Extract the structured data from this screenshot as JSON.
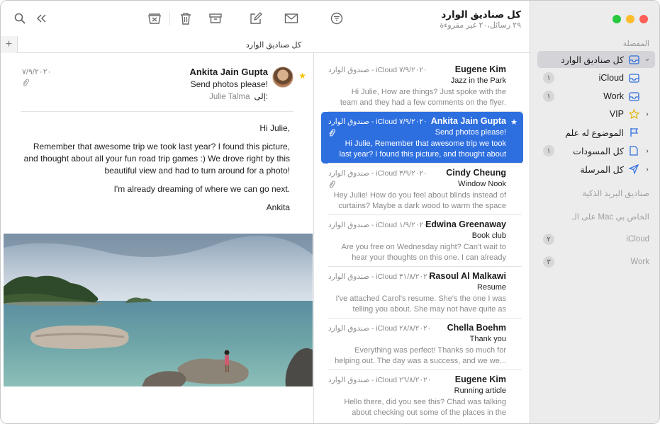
{
  "window": {
    "title": "كل صناديق الوارد",
    "subtitle": "٢٩ رسائل،٢٠ غير مقروءة"
  },
  "toolbar": {
    "search_icon": "search-icon",
    "collapse_icon": "double-chevron-left-icon",
    "junk_icon": "junk-icon",
    "trash_icon": "trash-icon",
    "archive_icon": "archive-icon",
    "compose_icon": "compose-icon",
    "mail_icon": "envelope-icon",
    "filter_icon": "filter-icon"
  },
  "tabbar": {
    "add_label": "+",
    "title": "كل صناديق الوارد"
  },
  "sidebar": {
    "favorites_label": "المفضلة",
    "items": [
      {
        "label": "كل صناديق الوارد",
        "badge": "",
        "icon": "inbox-icon"
      },
      {
        "label": "iCloud",
        "badge": "١",
        "icon": "inbox-icon"
      },
      {
        "label": "Work",
        "badge": "١",
        "icon": "inbox-icon"
      },
      {
        "label": "VIP",
        "badge": "",
        "icon": "star-icon"
      },
      {
        "label": "الموضوع له علم",
        "badge": "",
        "icon": "flag-icon"
      },
      {
        "label": "كل المسودات",
        "badge": "١",
        "icon": "document-icon"
      },
      {
        "label": "كل المرسلة",
        "badge": "",
        "icon": "paper-plane-icon"
      }
    ],
    "smart_mailboxes_label": "صناديق البريد الذكية",
    "on_my_mac_label": "على الـ Mac الخاص بي",
    "accounts": [
      {
        "label": "iCloud",
        "badge": "٢"
      },
      {
        "label": "Work",
        "badge": "٣"
      }
    ]
  },
  "messages": [
    {
      "sender": "Eugene Kim",
      "meta": "صندوق الوارد - iCloud   ٧/٩/٢٠٢٠",
      "subject": "Jazz in the Park",
      "preview": "Hi Julie, How are things? Just spoke with the team and they had a few comments on the flyer. Are yo...",
      "selected": false,
      "attachment": false,
      "starred": false
    },
    {
      "sender": "Ankita Jain Gupta",
      "meta": "صندوق الوارد - iCloud   ٧/٩/٢٠٢٠",
      "subject": "Send photos please!",
      "preview": "Hi Julie, Remember that awesome trip we took last year? I found this picture, and thought about all y...",
      "selected": true,
      "attachment": true,
      "starred": true
    },
    {
      "sender": "Cindy Cheung",
      "meta": "صندوق الوارد - iCloud   ٣/٩/٢٠٢٠",
      "subject": "Window Nook",
      "preview": "Hey Julie! How do you feel about blinds instead of curtains? Maybe a dark wood to warm the space a...",
      "selected": false,
      "attachment": true,
      "starred": false
    },
    {
      "sender": "Edwina Greenaway",
      "meta": "صندوق الوارد - iCloud   ١/٩/٢٠٢٠",
      "subject": "Book club",
      "preview": "Are you free on Wednesday night? Can't wait to hear your thoughts on this one. I can already gues...",
      "selected": false,
      "attachment": false,
      "starred": false
    },
    {
      "sender": "Rasoul Al Malkawi",
      "meta": "صندوق الوارد - iCloud   ٣١/٨/٢٠٢٠",
      "subject": "Resume",
      "preview": "I've attached Carol's resume. She's the one I was telling you about. She may not have quite as muc...",
      "selected": false,
      "attachment": false,
      "starred": false
    },
    {
      "sender": "Chella Boehm",
      "meta": "صندوق الوارد - iCloud   ٢٨/٨/٢٠٢٠",
      "subject": "Thank you",
      "preview": "Everything was perfect! Thanks so much for helping out. The day was a success, and we we...",
      "selected": false,
      "attachment": false,
      "starred": false
    },
    {
      "sender": "Eugene Kim",
      "meta": "صندوق الوارد - iCloud   ٢٦/٨/٢٠٢٠",
      "subject": "Running article",
      "preview": "Hello there, did you see this? Chad was talking about checking out some of the places in the arti...",
      "selected": false,
      "attachment": false,
      "starred": false
    }
  ],
  "reader": {
    "date": "٧/٩/٢٠٢٠",
    "from": "Ankita Jain Gupta",
    "subject": "Send photos please!",
    "to_label": "إلى:",
    "to_value": "Julie Talma",
    "body": [
      "Hi Julie,",
      "Remember that awesome trip we took last year? I found this picture, and thought about all your fun road trip games :) We drove right by this beautiful view and had to turn around for a photo!",
      "I'm already dreaming of where we can go next.",
      "Ankita"
    ]
  },
  "colors": {
    "accent": "#2e6fe0",
    "sidebar_bg": "#ececec",
    "star": "#f5c300"
  }
}
